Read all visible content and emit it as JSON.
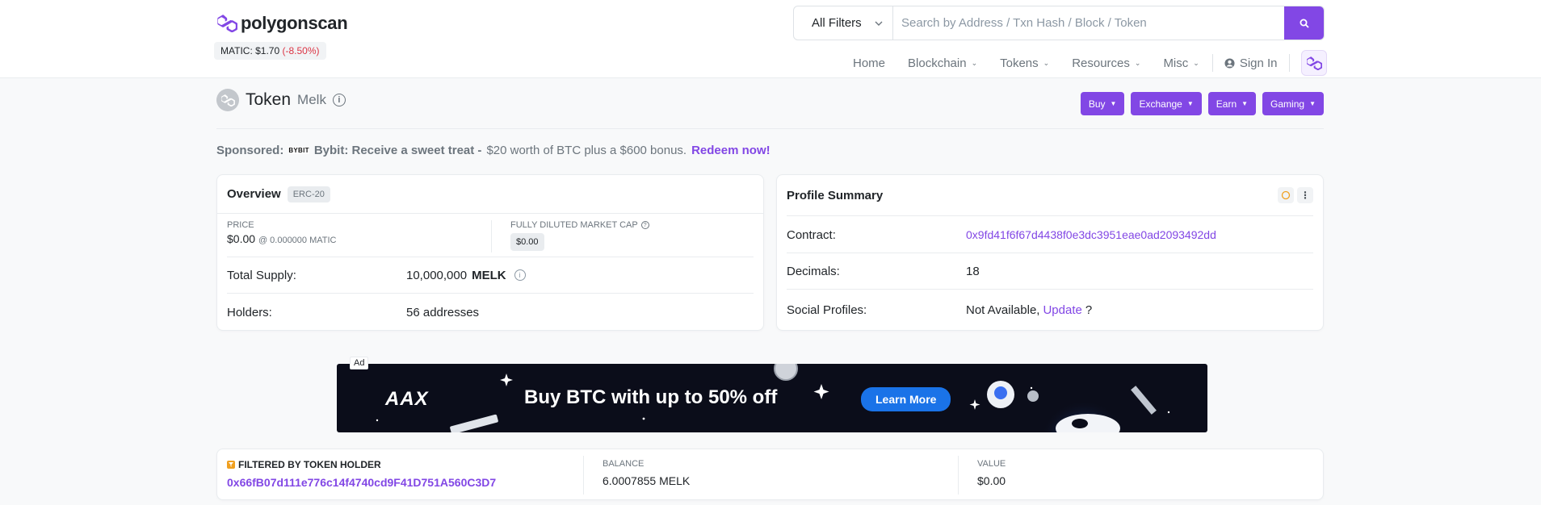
{
  "header": {
    "logo_text": "polygonscan",
    "price_label": "MATIC: $1.70",
    "price_change": "(-8.50%)",
    "search": {
      "filter_label": "All Filters",
      "placeholder": "Search by Address / Txn Hash / Block / Token"
    },
    "nav": [
      {
        "label": "Home",
        "has_caret": false
      },
      {
        "label": "Blockchain",
        "has_caret": true
      },
      {
        "label": "Tokens",
        "has_caret": true
      },
      {
        "label": "Resources",
        "has_caret": true
      },
      {
        "label": "Misc",
        "has_caret": true
      }
    ],
    "sign_in": "Sign In"
  },
  "page": {
    "title": "Token",
    "subtitle": "Melk",
    "actions": [
      "Buy",
      "Exchange",
      "Earn",
      "Gaming"
    ]
  },
  "sponsored": {
    "label": "Sponsored:",
    "brand_mark": "BYBIT",
    "headline": "Bybit: Receive a sweet treat -",
    "text": "$20 worth of BTC plus a $600 bonus.",
    "cta": "Redeem now!"
  },
  "overview": {
    "title": "Overview",
    "badge": "ERC-20",
    "price_label": "PRICE",
    "price_value": "$0.00",
    "price_sub": "@ 0.000000 MATIC",
    "fdmc_label": "FULLY DILUTED MARKET CAP",
    "fdmc_value": "$0.00",
    "total_supply_label": "Total Supply:",
    "total_supply_value": "10,000,000",
    "total_supply_symbol": "MELK",
    "holders_label": "Holders:",
    "holders_value": "56 addresses"
  },
  "profile": {
    "title": "Profile Summary",
    "contract_label": "Contract:",
    "contract_value": "0x9fd41f6f67d4438f0e3dc3951eae0ad2093492dd",
    "decimals_label": "Decimals:",
    "decimals_value": "18",
    "social_label": "Social Profiles:",
    "social_value": "Not Available,",
    "social_link": "Update",
    "social_suffix": "?"
  },
  "ad": {
    "label": "Ad",
    "brand": "AAX",
    "headline": "Buy BTC with up to 50% off",
    "cta": "Learn More"
  },
  "filter": {
    "title": "FILTERED BY TOKEN HOLDER",
    "address": "0x66fB07d111e776c14f4740cd9F41D751A560C3D7",
    "balance_label": "BALANCE",
    "balance_value": "6.0007855 MELK",
    "value_label": "VALUE",
    "value_value": "$0.00"
  },
  "colors": {
    "brand": "#8247e5",
    "negative": "#dc3545",
    "text_muted": "#6c757d"
  }
}
